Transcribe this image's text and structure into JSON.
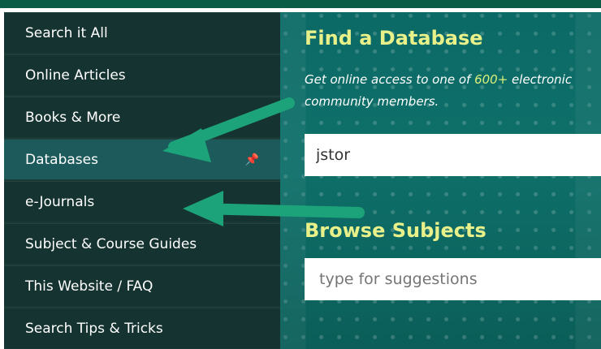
{
  "sidebar": {
    "items": [
      {
        "label": "Search it All"
      },
      {
        "label": "Online Articles"
      },
      {
        "label": "Books & More"
      },
      {
        "label": "Databases",
        "active": true
      },
      {
        "label": "e-Journals"
      },
      {
        "label": "Subject & Course Guides"
      },
      {
        "label": "This Website / FAQ"
      },
      {
        "label": "Search Tips & Tricks"
      }
    ],
    "pin_icon": "📌"
  },
  "main": {
    "title": "Find a Database",
    "subtitle_prefix": "Get online access to one of ",
    "subtitle_highlight": "600+",
    "subtitle_suffix": " electronic",
    "subtitle_line2": "community members.",
    "search_value": "jstor",
    "browse_title": "Browse Subjects",
    "subject_placeholder": "type for suggestions"
  },
  "colors": {
    "sidebar_bg": "#153330",
    "active_bg": "#1d5a5c",
    "accent_yellow": "#e8f08a",
    "arrow_green": "#1ca37a",
    "panel_teal": "#0c6a66"
  }
}
